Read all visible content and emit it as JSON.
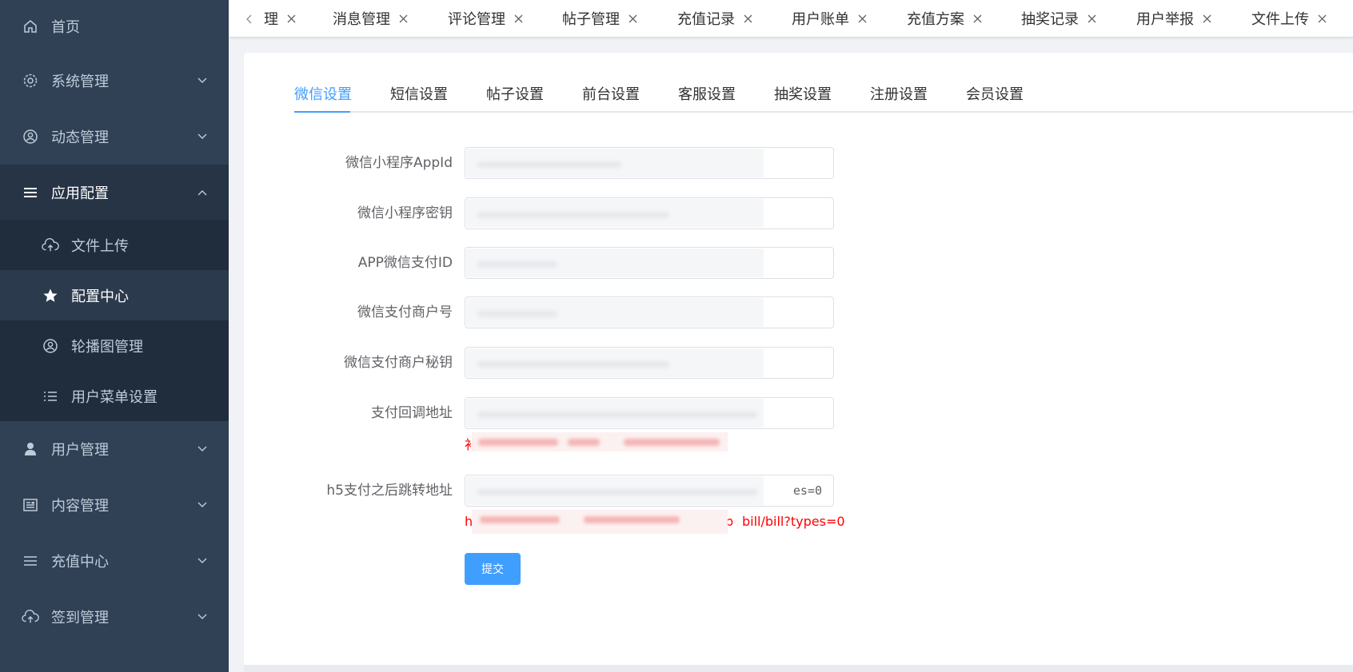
{
  "sidebar": {
    "items": [
      {
        "label": "首页",
        "icon": "home-icon",
        "has_arrow": false
      },
      {
        "label": "系统管理",
        "icon": "gear-icon",
        "has_arrow": true
      },
      {
        "label": "动态管理",
        "icon": "user-circle-icon",
        "has_arrow": true
      },
      {
        "label": "应用配置",
        "icon": "menu-icon",
        "has_arrow": true,
        "open": true
      },
      {
        "label": "用户管理",
        "icon": "user-icon",
        "has_arrow": true
      },
      {
        "label": "内容管理",
        "icon": "document-icon",
        "has_arrow": true
      },
      {
        "label": "充值中心",
        "icon": "menu-icon",
        "has_arrow": true
      },
      {
        "label": "签到管理",
        "icon": "cloud-upload-icon",
        "has_arrow": true
      }
    ],
    "submenu": [
      {
        "label": "文件上传",
        "icon": "cloud-upload-icon"
      },
      {
        "label": "配置中心",
        "icon": "star-icon",
        "active": true
      },
      {
        "label": "轮播图管理",
        "icon": "user-circle-icon"
      },
      {
        "label": "用户菜单设置",
        "icon": "list-icon"
      }
    ]
  },
  "tagsbar": {
    "tags": [
      "理",
      "消息管理",
      "评论管理",
      "帖子管理",
      "充值记录",
      "用户账单",
      "充值方案",
      "抽奖记录",
      "用户举报",
      "文件上传"
    ]
  },
  "tabs": [
    "微信设置",
    "短信设置",
    "帖子设置",
    "前台设置",
    "客服设置",
    "抽奖设置",
    "注册设置",
    "会员设置"
  ],
  "active_tab": "微信设置",
  "form": {
    "fields": [
      {
        "label": "微信小程序AppId",
        "value": ""
      },
      {
        "label": "微信小程序密钥",
        "value": ""
      },
      {
        "label": "APP微信支付ID",
        "value": ""
      },
      {
        "label": "微信支付商户号",
        "value": ""
      },
      {
        "label": "微信支付商户秘钥",
        "value": ""
      },
      {
        "label": "支付回调地址",
        "value": ""
      },
      {
        "label": "h5支付之后跳转地址",
        "value": "es=0"
      }
    ],
    "h5_hint_visible": "bill/bill?types=0",
    "h5_hint_prefix": "h",
    "h5_hint_fragment": "p",
    "callback_hint_prefix": "补",
    "submit_label": "提交"
  },
  "colors": {
    "sidebar_bg": "#304156",
    "submenu_bg": "#1f2d3d",
    "primary": "#409eff",
    "error_text": "#ff0000"
  }
}
